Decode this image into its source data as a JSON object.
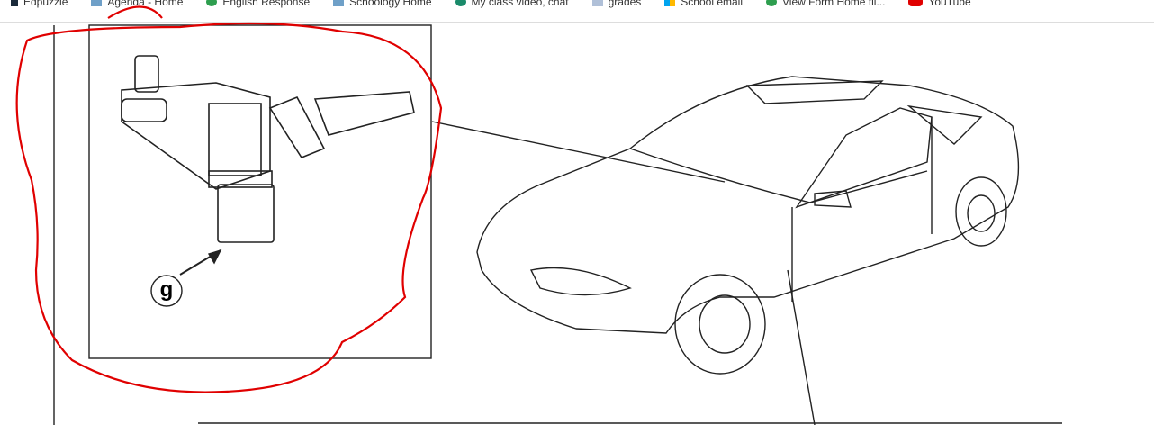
{
  "bookmarks": [
    {
      "label": "Edpuzzle",
      "icon": "edpuzzle-icon",
      "color": "#1a2a3a"
    },
    {
      "label": "Agenda - Home",
      "icon": "folder-icon",
      "color": "#6fa0c8"
    },
    {
      "label": "English Response",
      "icon": "drive-icon",
      "color": "#2e9e4f"
    },
    {
      "label": "Schoology Home",
      "icon": "folder-icon",
      "color": "#6fa0c8"
    },
    {
      "label": "My class video, chat",
      "icon": "map-pin-icon",
      "color": "#1a8a6a"
    },
    {
      "label": "grades",
      "icon": "page-icon",
      "color": "#b0c0d8"
    },
    {
      "label": "School email",
      "icon": "windows-icon",
      "color": "#f4a400"
    },
    {
      "label": "View Form Home fil...",
      "icon": "drive-icon",
      "color": "#2e9e4f"
    },
    {
      "label": "YouTube",
      "icon": "youtube-icon",
      "color": "#e00000"
    }
  ],
  "diagram": {
    "callout": "g",
    "annotation_color": "#e00000"
  }
}
